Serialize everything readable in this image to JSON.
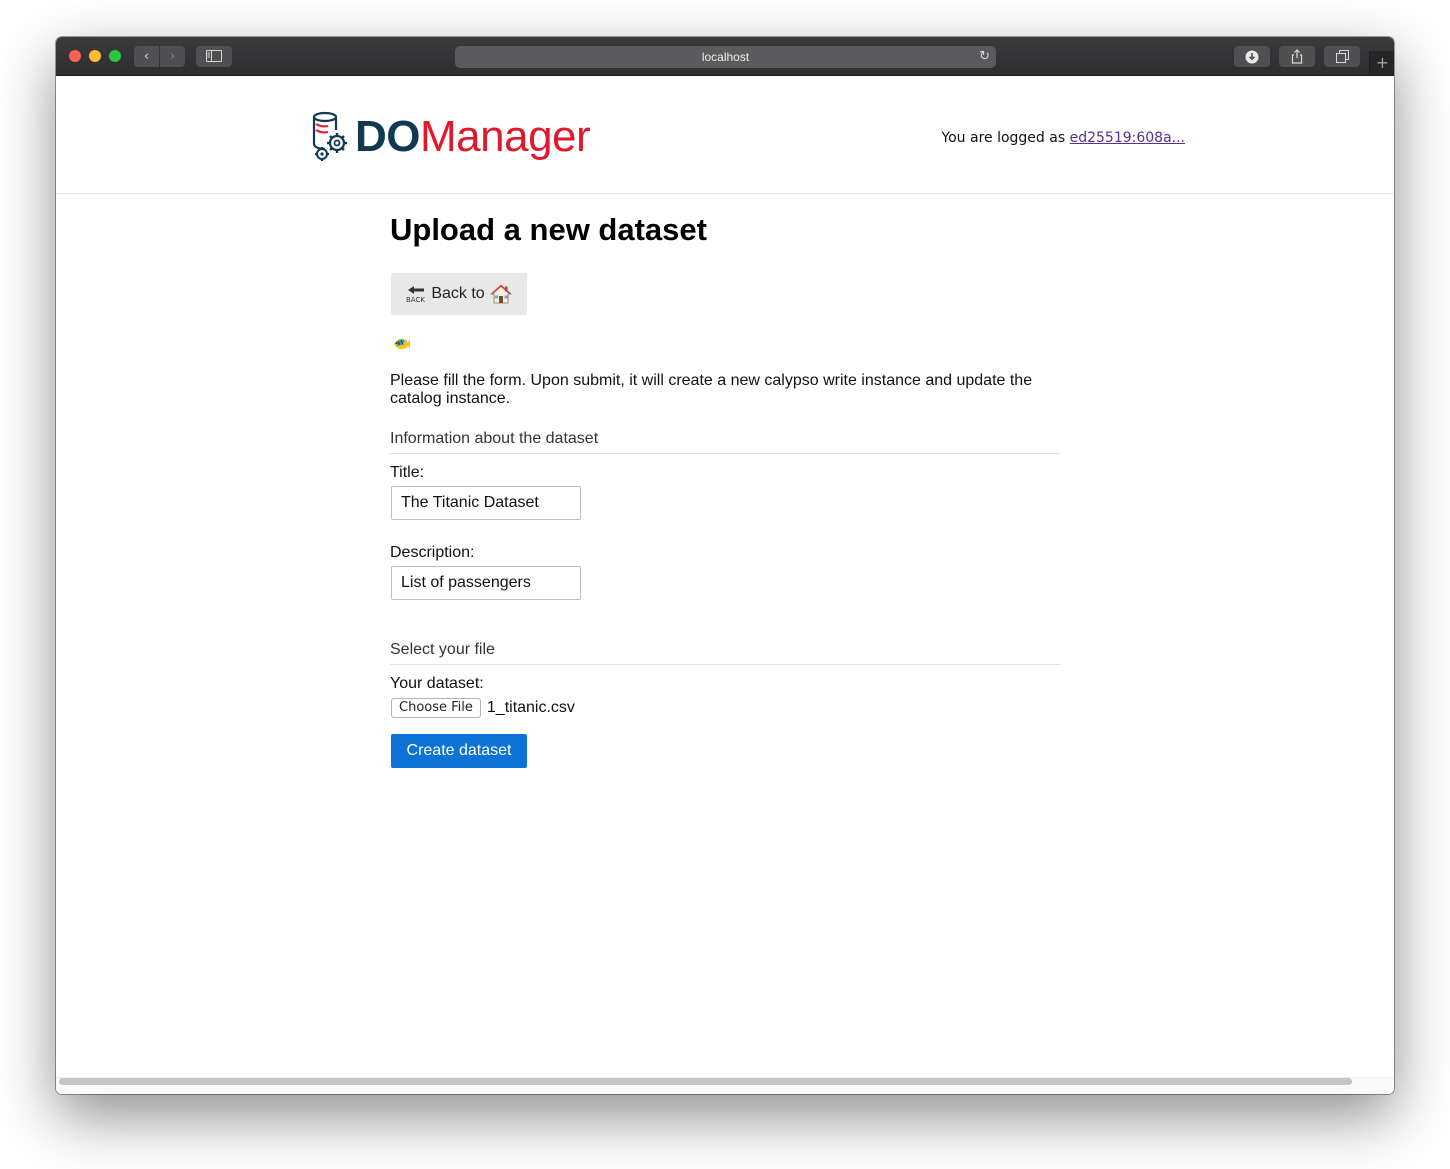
{
  "browser": {
    "url": "localhost",
    "nav_back_glyph": "‹",
    "nav_forward_glyph": "›",
    "reload_glyph": "↻",
    "new_tab_glyph": "+"
  },
  "header": {
    "logo_part1": "DO",
    "logo_part2": "Manager",
    "logged_prefix": "You are logged as ",
    "user_link": "ed25519:608a..."
  },
  "page": {
    "title": "Upload a new dataset",
    "back_label": "Back to",
    "intro": "Please fill the form. Upon submit, it will create a new calypso write instance and update the catalog instance."
  },
  "form": {
    "section_info": "Information about the dataset",
    "title_label": "Title:",
    "title_value": "The Titanic Dataset",
    "description_label": "Description:",
    "description_value": "List of passengers",
    "section_file": "Select your file",
    "dataset_label": "Your dataset:",
    "choose_file_label": "Choose File",
    "file_name": "1_titanic.csv",
    "submit_label": "Create dataset"
  },
  "colors": {
    "brand_dark": "#0f3a50",
    "brand_red": "#e0192d",
    "primary_button": "#0d72d6"
  }
}
